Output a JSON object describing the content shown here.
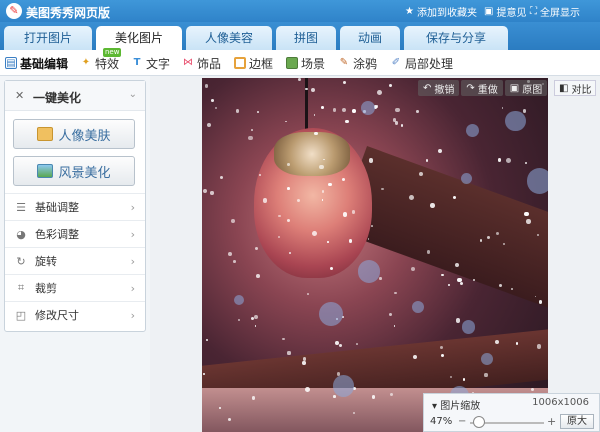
{
  "app_title": "美图秀秀网页版",
  "logo_glyph": "✎",
  "titlebar_links": [
    {
      "label": "添加到收藏夹",
      "icon": "star-icon"
    },
    {
      "label": "提意见",
      "icon": "feedback-icon"
    },
    {
      "label": "全屏显示",
      "icon": "fullscreen-icon"
    }
  ],
  "main_tabs": [
    "打开图片",
    "美化图片",
    "人像美容",
    "拼图",
    "动画",
    "保存与分享"
  ],
  "active_main_tab": "美化图片",
  "toolbar": [
    {
      "label": "基础编辑",
      "icon": "basic-edit-icon"
    },
    {
      "label": "特效",
      "icon": "effects-icon"
    },
    {
      "label": "文字",
      "icon": "text-icon"
    },
    {
      "label": "饰品",
      "icon": "accessory-icon"
    },
    {
      "label": "边框",
      "icon": "frame-icon"
    },
    {
      "label": "场景",
      "icon": "scene-icon"
    },
    {
      "label": "涂鸦",
      "icon": "doodle-icon"
    },
    {
      "label": "局部处理",
      "icon": "local-process-icon"
    }
  ],
  "new_badge": "new",
  "left_panel": {
    "one_key_title": "一键美化",
    "buttons": [
      {
        "label": "人像美肤",
        "icon": "portrait-icon"
      },
      {
        "label": "风景美化",
        "icon": "landscape-icon"
      }
    ],
    "menu": [
      {
        "label": "基础调整",
        "icon": "sliders-icon"
      },
      {
        "label": "色彩调整",
        "icon": "palette-icon"
      },
      {
        "label": "旋转",
        "icon": "rotate-icon"
      },
      {
        "label": "裁剪",
        "icon": "crop-icon"
      },
      {
        "label": "修改尺寸",
        "icon": "resize-icon"
      }
    ]
  },
  "edit_actions": [
    {
      "label": "撤销",
      "icon": "undo-icon"
    },
    {
      "label": "重做",
      "icon": "redo-icon"
    },
    {
      "label": "原图",
      "icon": "original-icon"
    }
  ],
  "compare_label": "对比",
  "zoom": {
    "title": "图片缩放",
    "size": "1006x1006",
    "percent": "47%",
    "original_button": "原大",
    "level": 0.47
  },
  "colors": {
    "titlebar": "#3f97d9",
    "accent": "#2b7cc1",
    "new_badge": "#5cb832"
  }
}
